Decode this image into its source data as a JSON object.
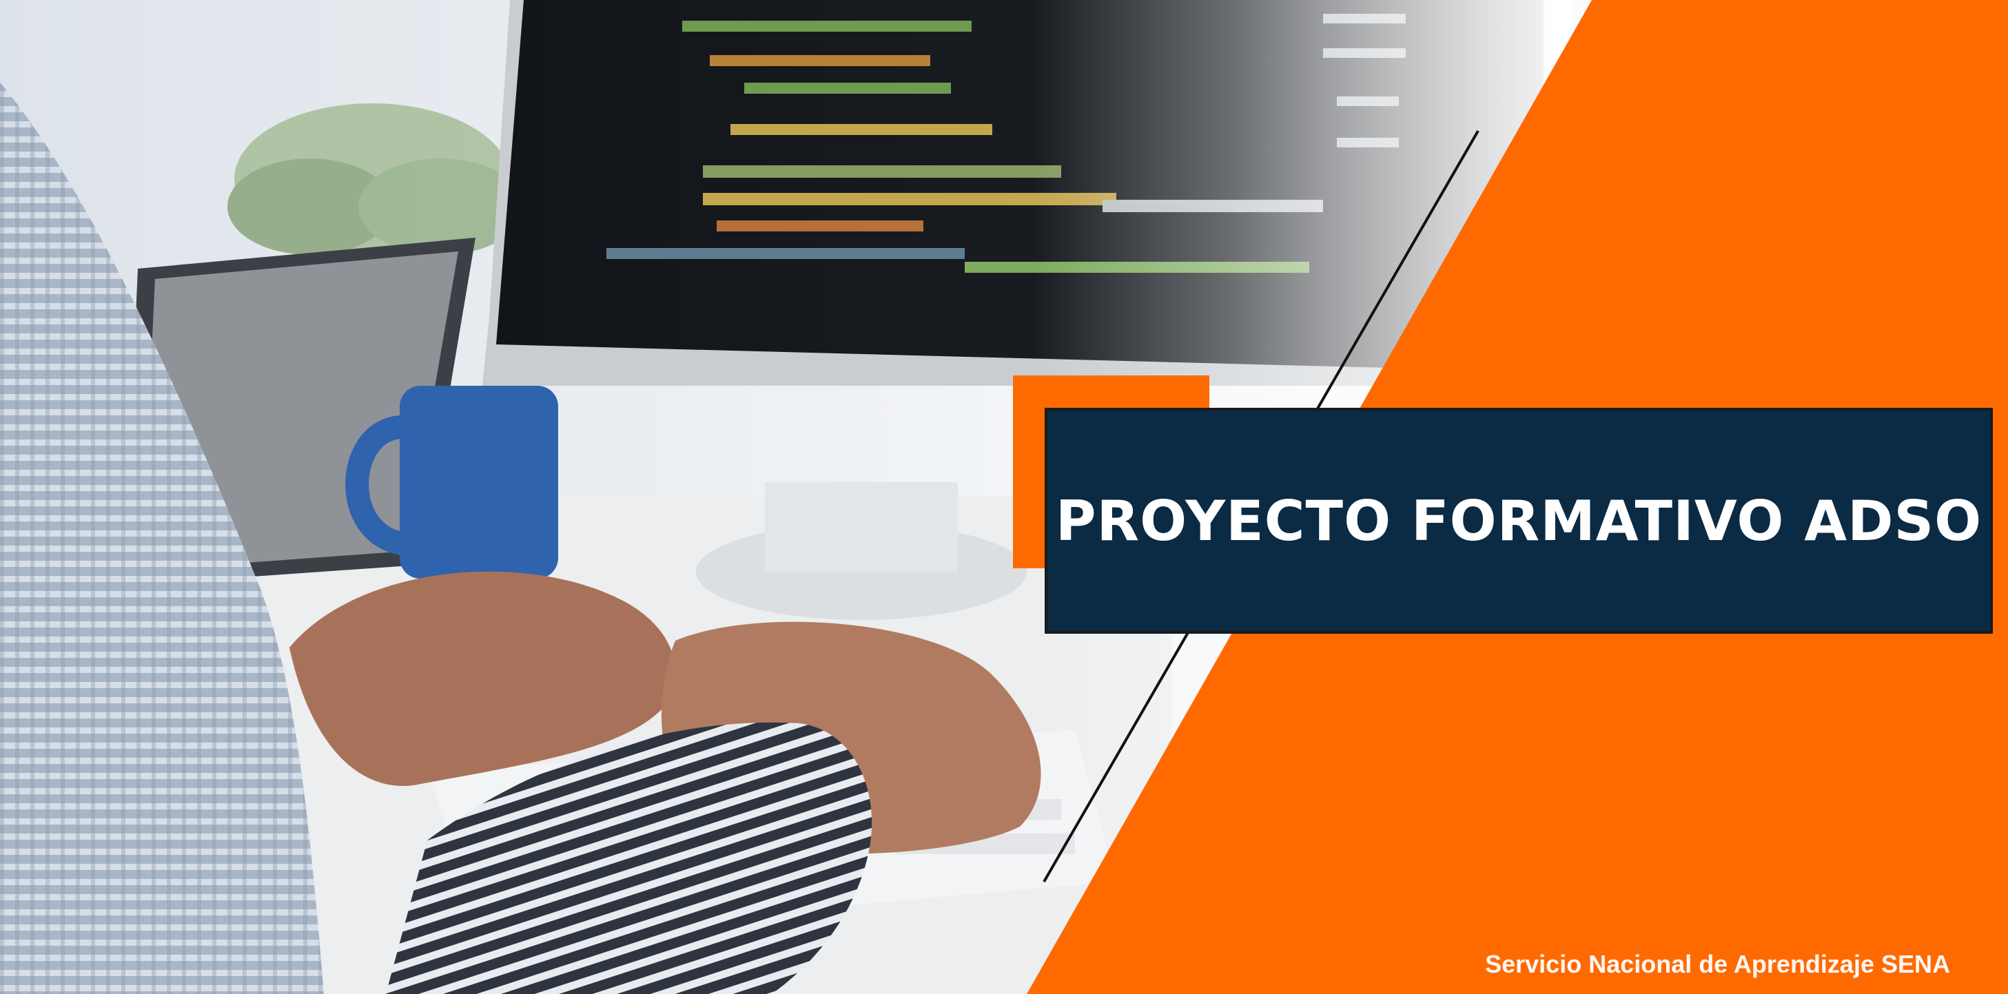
{
  "banner": {
    "title": "PROYECTO FORMATIVO ADSO",
    "footer": "Servicio Nacional de Aprendizaje SENA"
  },
  "colors": {
    "accent_orange": "#ff6a00",
    "title_box_navy": "#0b2a43",
    "text_white": "#ffffff"
  },
  "photo": {
    "description_icons": [
      "monitor-icon",
      "tablet-icon",
      "mug-icon",
      "keyboard-icon",
      "hands-icon"
    ]
  }
}
